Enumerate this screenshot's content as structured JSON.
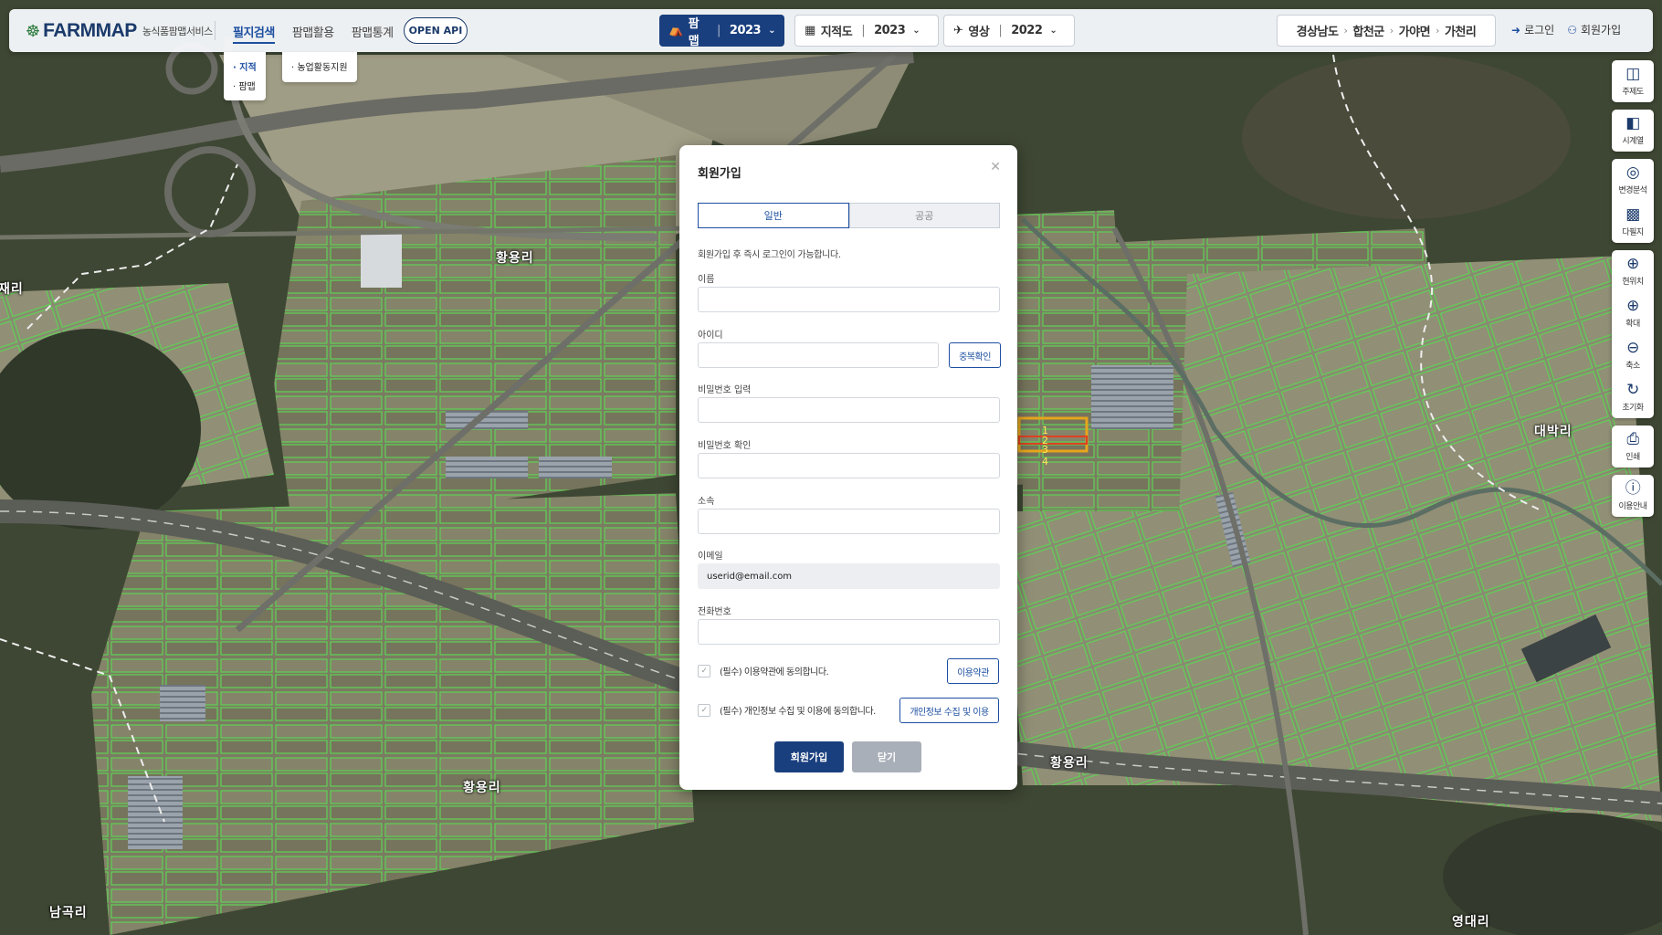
{
  "logo": {
    "mark": "☸",
    "name": "FARMMAP",
    "sub": "농식품팜맵서비스"
  },
  "nav": {
    "items": [
      "필지검색",
      "팜맵활용",
      "팜맵통계"
    ],
    "open_api": "OPEN API"
  },
  "submenu": {
    "search": [
      "· 지적",
      "· 팜맵"
    ],
    "use": [
      "· 농업활동지원"
    ]
  },
  "layers": {
    "farmmap": {
      "label": "팜맵",
      "year": "2023",
      "icon": "farm-icon"
    },
    "cadastral": {
      "label": "지적도",
      "year": "2023",
      "icon": "cadastral-icon"
    },
    "image": {
      "label": "영상",
      "year": "2022",
      "icon": "plane-icon"
    }
  },
  "breadcrumb": [
    "경상남도",
    "합천군",
    "가야면",
    "가천리"
  ],
  "auth": {
    "login": "로그인",
    "signup": "회원가입"
  },
  "tools": [
    "주제도",
    "시계열",
    "변경분석",
    "다필지",
    "현위치",
    "확대",
    "축소",
    "초기화",
    "인쇄",
    "이용안내"
  ],
  "map_labels": [
    "황용리",
    "황용리",
    "황용리",
    "황용리",
    "대박리",
    "남곡리",
    "영대리",
    "재리"
  ],
  "parcel_numbers": [
    "1",
    "2",
    "3",
    "4"
  ],
  "modal": {
    "title": "회원가입",
    "tabs": [
      "일반",
      "공공"
    ],
    "notice": "회원가입 후 즉시 로그인이 가능합니다.",
    "fields": {
      "name": {
        "label": "이름",
        "value": ""
      },
      "id": {
        "label": "아이디",
        "value": "",
        "check_button": "중복확인"
      },
      "password": {
        "label": "비밀번호 입력",
        "value": ""
      },
      "password_confirm": {
        "label": "비밀번호 확인",
        "value": ""
      },
      "affiliation": {
        "label": "소속",
        "value": ""
      },
      "email": {
        "label": "이메일",
        "value": "userid@email.com"
      },
      "phone": {
        "label": "전화번호",
        "value": ""
      }
    },
    "agreements": [
      {
        "text": "(필수) 이용약관에 동의합니다.",
        "button": "이용약관"
      },
      {
        "text": "(필수) 개인정보 수집 및 이용에 동의합니다.",
        "button": "개인정보 수집 및 이용"
      }
    ],
    "submit": "회원가입",
    "close": "닫기"
  },
  "colors": {
    "brand": "#1a3f7e",
    "accent": "#1d4fa0",
    "parcel_outline": "#66e05a",
    "highlight": "#e6a51c"
  }
}
